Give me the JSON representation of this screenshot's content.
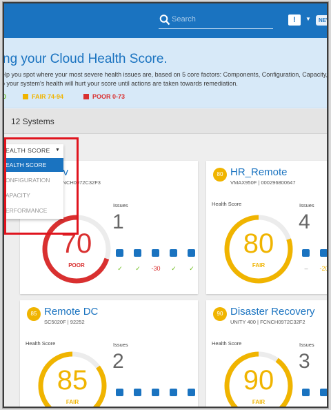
{
  "header": {
    "search_placeholder": "Search",
    "alert_icon": "!",
    "new_badge": "NEW"
  },
  "banner": {
    "title": "ng your Cloud Health Score.",
    "line1": "elp you spot where your most severe health issues are, based on 5 core factors: Components, Configuration, Capacity, P",
    "line2": "o your system's health will hurt your score until actions are taken towards remediation.",
    "legend": {
      "good": "0",
      "fair": "FAIR 74-94",
      "poor": "POOR 0-73"
    }
  },
  "subbar": {
    "count": "12 Systems"
  },
  "dropdown": {
    "label": "EALTH SCORE",
    "items": [
      "EALTH SCORE",
      "ONFIGURATION",
      "APACITY",
      "ERFORMANCE"
    ],
    "selected_index": 0
  },
  "colors": {
    "brand": "#1a73c0",
    "good": "#6bbd1a",
    "fair": "#f0b400",
    "poor": "#d93030",
    "highlight": "#e0141e"
  },
  "cards": [
    {
      "badge": "",
      "name": "_Dev",
      "model": "GA | FCNCH0972C32F3",
      "health_score_label": "",
      "issues_label": "Issues",
      "issues": "1",
      "score": 70,
      "score_text": "70",
      "status": "POOR",
      "status_color": "#d93030",
      "marks": [
        "✓",
        "✓",
        "-30",
        "✓",
        "✓"
      ]
    },
    {
      "badge": "80",
      "name": "HR_Remote",
      "model": "VMAX950F | 000296800647",
      "health_score_label": "Health Score",
      "issues_label": "Issues",
      "issues": "4",
      "score": 80,
      "score_text": "80",
      "status": "FAIR",
      "status_color": "#f0b400",
      "marks": [
        "–",
        "-20"
      ]
    },
    {
      "badge": "85",
      "name": "Remote DC",
      "model": "SC5020F | 92252",
      "health_score_label": "Health Score",
      "issues_label": "Issues",
      "issues": "2",
      "score": 85,
      "score_text": "85",
      "status": "FAIR",
      "status_color": "#f0b400",
      "marks": []
    },
    {
      "badge": "90",
      "name": "Disaster Recovery",
      "model": "UNITY 400 | FCNCH0972C32F2",
      "health_score_label": "Health Score",
      "issues_label": "Issues",
      "issues": "3",
      "score": 90,
      "score_text": "90",
      "status": "FAIR",
      "status_color": "#f0b400",
      "marks": []
    }
  ]
}
